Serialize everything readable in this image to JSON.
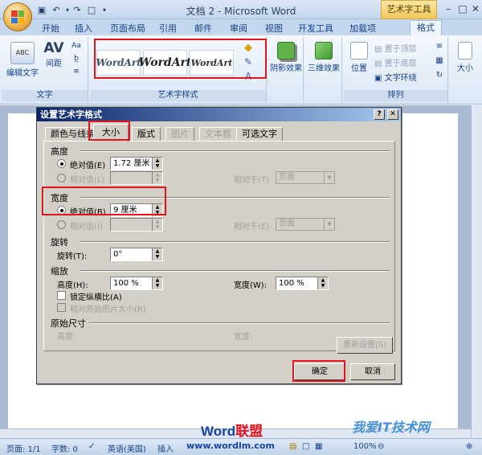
{
  "window": {
    "title": "文档 2 - Microsoft Word",
    "context_tab": "艺术字工具"
  },
  "tabs": [
    "开始",
    "插入",
    "页面布局",
    "引用",
    "邮件",
    "审阅",
    "视图",
    "开发工具",
    "加载项",
    "格式"
  ],
  "ribbon": {
    "text_group": {
      "label": "文字",
      "edit_text": "编辑文字",
      "spacing": "间距"
    },
    "wordart_group": {
      "label": "艺术字样式",
      "samples": [
        "WordArt",
        "WordArt",
        "WordArt"
      ]
    },
    "effects": {
      "shadow": "阴影效果",
      "three_d": "三维效果"
    },
    "arrange_group": {
      "label": "排列",
      "position": "位置",
      "bring_front": "置于顶层",
      "send_back": "置于底层",
      "text_wrap": "文字环绕"
    },
    "size": "大小"
  },
  "dialog": {
    "title": "设置艺术字格式",
    "tabs": [
      {
        "label": "颜色与线条"
      },
      {
        "label": "大小"
      },
      {
        "label": "版式"
      },
      {
        "label": "图片"
      },
      {
        "label": "文本框"
      },
      {
        "label": "可选文字"
      }
    ],
    "height": {
      "section": "高度",
      "absolute_label": "绝对值(E)",
      "absolute_value": "1.72 厘米",
      "relative_label": "相对值(L)",
      "relative_to": "相对于(T)",
      "relative_to_value": "页面"
    },
    "width": {
      "section": "宽度",
      "absolute_label": "绝对值(B)",
      "absolute_value": "9 厘米",
      "relative_label": "相对值(I)",
      "relative_to": "相对于(E)",
      "relative_to_value": "页面"
    },
    "rotate": {
      "section": "旋转",
      "label": "旋转(T):",
      "value": "0°"
    },
    "scale": {
      "section": "缩放",
      "height_label": "高度(H):",
      "height_value": "100 %",
      "width_label": "宽度(W):",
      "width_value": "100 %",
      "lock_aspect": "锁定纵横比(A)",
      "relative_original": "相对原始图片大小(R)"
    },
    "original": {
      "section": "原始尺寸",
      "height_label": "高度:",
      "width_label": "宽度:",
      "reset": "重新设置(S)"
    },
    "ok": "确定",
    "cancel": "取消"
  },
  "status": {
    "page": "页面: 1/1",
    "words": "字数: 0",
    "language": "英语(美国)",
    "insert": "插入",
    "zoom": "100%"
  },
  "watermarks": {
    "brand_a": "Word",
    "brand_b": "联盟",
    "url": "www.wordlm.com",
    "right": "我爱IT技术网"
  },
  "colors": {
    "title_blue": "#0a246a",
    "highlight_red": "#e0141c",
    "ribbon_text": "#15428b"
  }
}
